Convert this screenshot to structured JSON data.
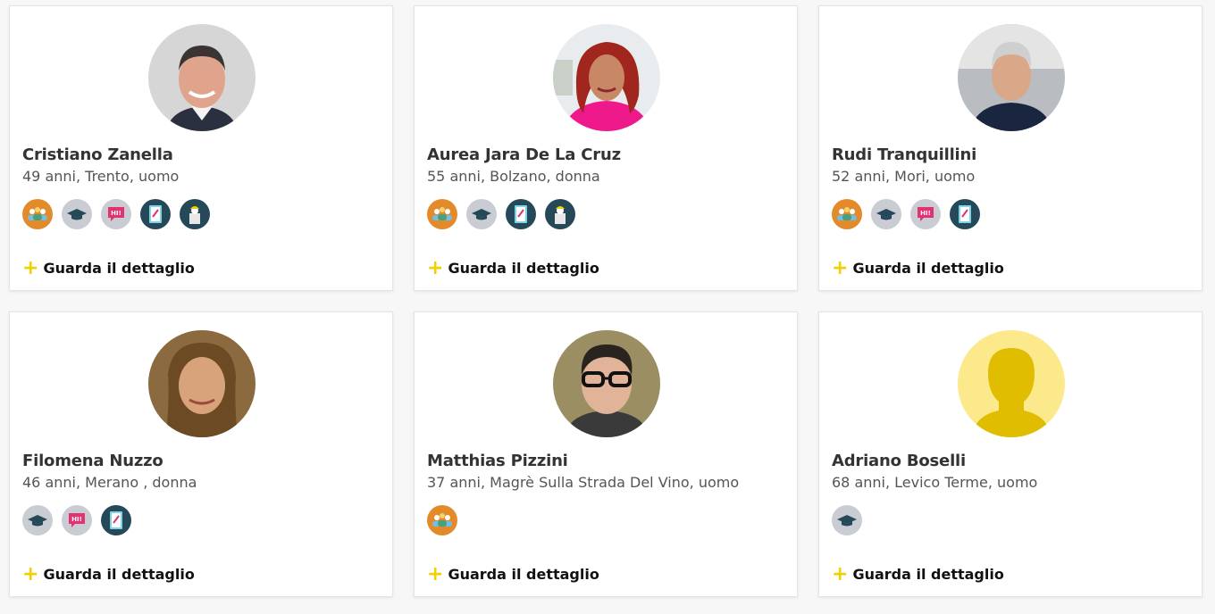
{
  "link_label": "Guarda il dettaglio",
  "lang_badge_text": "HI!",
  "accent_color": "#f2cf00",
  "profiles": [
    {
      "name": "Cristiano Zanella",
      "info": "49 anni, Trento, uomo",
      "icons": [
        "group-icon",
        "graduation-cap-icon",
        "speech-bubble-icon",
        "document-icon",
        "worker-icon"
      ]
    },
    {
      "name": "Aurea Jara De La Cruz",
      "info": "55 anni, Bolzano, donna",
      "icons": [
        "group-icon",
        "graduation-cap-icon",
        "document-icon",
        "worker-icon"
      ]
    },
    {
      "name": "Rudi Tranquillini",
      "info": "52 anni, Mori, uomo",
      "icons": [
        "group-icon",
        "graduation-cap-icon",
        "speech-bubble-icon",
        "document-icon"
      ]
    },
    {
      "name": "Filomena Nuzzo",
      "info": "46 anni, Merano , donna",
      "icons": [
        "graduation-cap-icon",
        "speech-bubble-icon",
        "document-icon"
      ]
    },
    {
      "name": "Matthias Pizzini",
      "info": "37 anni, Magrè Sulla Strada Del Vino, uomo",
      "icons": [
        "group-icon"
      ]
    },
    {
      "name": "Adriano Boselli",
      "info": "68 anni, Levico Terme, uomo",
      "icons": [
        "graduation-cap-icon"
      ]
    }
  ]
}
